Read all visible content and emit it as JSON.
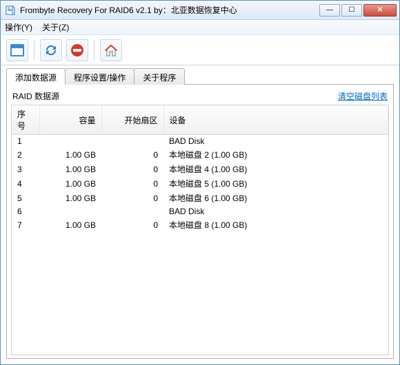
{
  "titlebar": {
    "title": "Frombyte Recovery For RAID6 v2.1 by：北亚数据恢复中心"
  },
  "menubar": {
    "items": [
      {
        "label": "操作(Y)"
      },
      {
        "label": "关于(Z)"
      }
    ]
  },
  "tabs": {
    "items": [
      {
        "label": "添加数据源",
        "active": true
      },
      {
        "label": "程序设置/操作",
        "active": false
      },
      {
        "label": "关于程序",
        "active": false
      }
    ]
  },
  "section": {
    "title": "RAID 数据源",
    "action_link": "清空磁盘列表"
  },
  "table": {
    "headers": {
      "index": "序号",
      "capacity": "容量",
      "start_sector": "开始扇区",
      "device": "设备"
    },
    "rows": [
      {
        "index": "1",
        "capacity": "",
        "start_sector": "",
        "device": "BAD Disk"
      },
      {
        "index": "2",
        "capacity": "1.00 GB",
        "start_sector": "0",
        "device": "本地磁盘 2  (1.00 GB)"
      },
      {
        "index": "3",
        "capacity": "1.00 GB",
        "start_sector": "0",
        "device": "本地磁盘 4  (1.00 GB)"
      },
      {
        "index": "4",
        "capacity": "1.00 GB",
        "start_sector": "0",
        "device": "本地磁盘 5  (1.00 GB)"
      },
      {
        "index": "5",
        "capacity": "1.00 GB",
        "start_sector": "0",
        "device": "本地磁盘 6  (1.00 GB)"
      },
      {
        "index": "6",
        "capacity": "",
        "start_sector": "",
        "device": "BAD Disk"
      },
      {
        "index": "7",
        "capacity": "1.00 GB",
        "start_sector": "0",
        "device": "本地磁盘 8  (1.00 GB)"
      }
    ]
  },
  "icons": {
    "minimize": "—",
    "maximize": "☐",
    "close": "✕"
  }
}
